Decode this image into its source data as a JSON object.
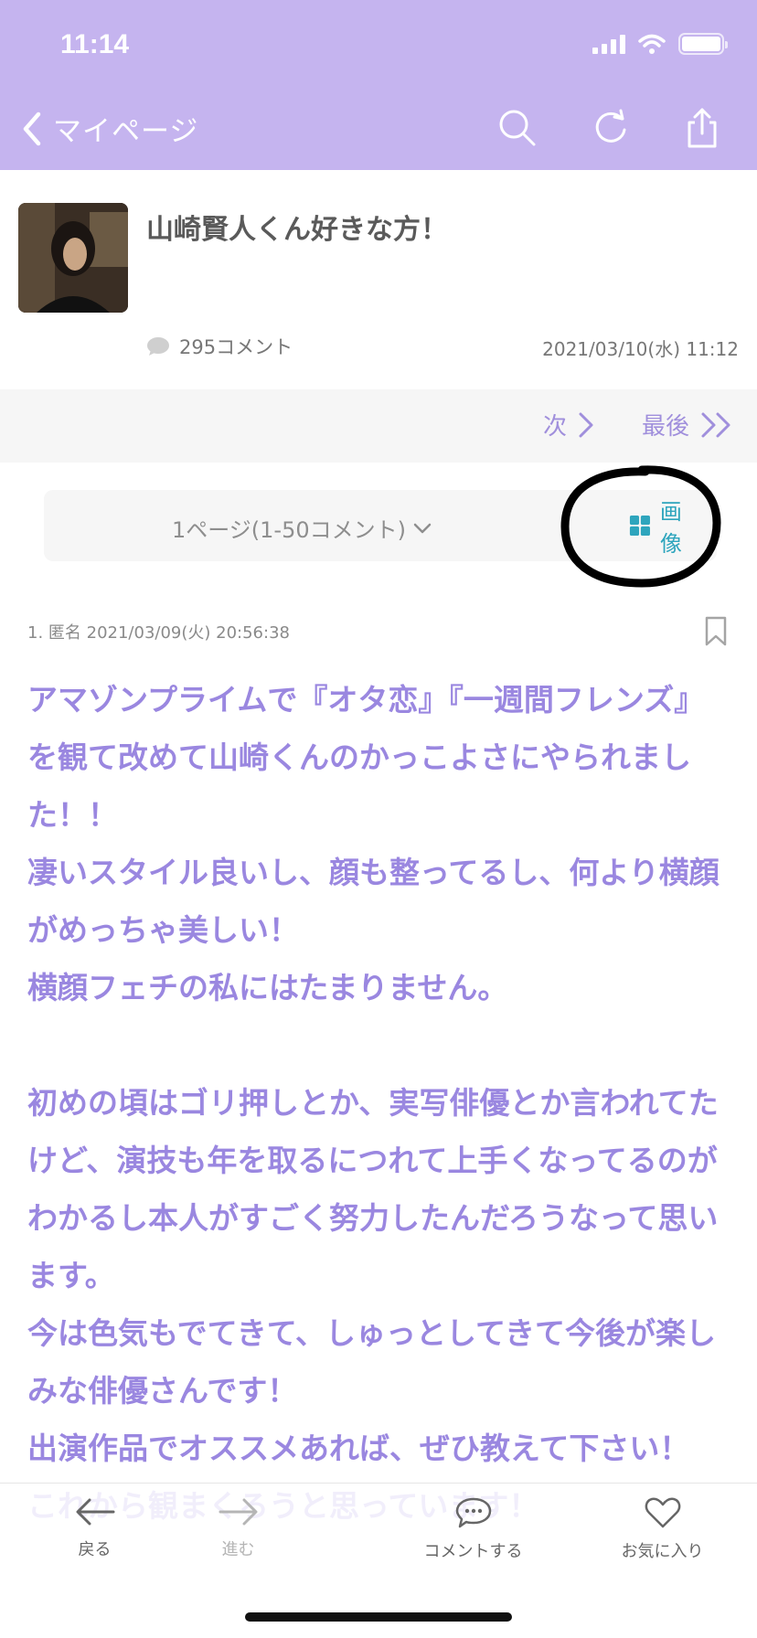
{
  "status_bar": {
    "time": "11:14"
  },
  "nav": {
    "back_label": "マイページ",
    "actions": [
      "search-icon",
      "reload-icon",
      "share-icon"
    ]
  },
  "topic": {
    "title": "山崎賢人くん好きな方！",
    "comment_count": "295コメント",
    "date": "2021/03/10(水) 11:12"
  },
  "pager": {
    "next_label": "次",
    "last_label": "最後"
  },
  "page_select": {
    "label": "1ページ(1-50コメント)",
    "image_label": "画像"
  },
  "post": {
    "meta": "1. 匿名 2021/03/09(火) 20:56:38",
    "body": "アマゾンプライムで『オタ恋』『一週間フレンズ』を観て改めて山崎くんのかっこよさにやられました！！\n凄いスタイル良いし、顔も整ってるし、何より横顔がめっちゃ美しい！\n横顔フェチの私にはたまりません。\n\n初めの頃はゴリ押しとか、実写俳優とか言われてたけど、演技も年を取るにつれて上手くなってるのがわかるし本人がすごく努力したんだろうなって思います。\n今は色気もでてきて、しゅっとしてきて今後が楽しみな俳優さんです！\n出演作品でオススメあれば、ぜひ教えて下さい！\nこれから観まくろうと思っています！"
  },
  "toolbar": {
    "back_label": "戻る",
    "forward_label": "進む",
    "comment_label": "コメントする",
    "favorite_label": "お気に入り"
  },
  "colors": {
    "header": "#c5b4ef",
    "accent": "#9a87e0",
    "image_button": "#2ea5bd",
    "annotation": "#000000"
  }
}
